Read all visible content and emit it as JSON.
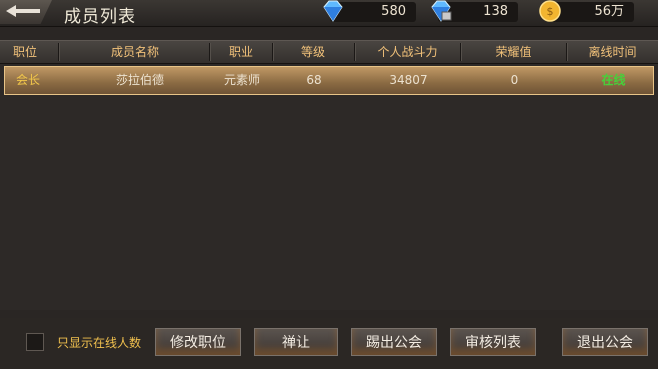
{
  "header": {
    "title": "成员列表",
    "resources": [
      {
        "icon": "diamond-icon",
        "value": "580"
      },
      {
        "icon": "bound-diamond-icon",
        "value": "138"
      },
      {
        "icon": "gold-coin-icon",
        "value": "56万"
      }
    ]
  },
  "table": {
    "columns": [
      "职位",
      "成员名称",
      "职业",
      "等级",
      "个人战斗力",
      "荣耀值",
      "离线时间"
    ],
    "rows": [
      [
        "会长",
        "莎拉伯德",
        "元素师",
        "68",
        "34807",
        "0",
        "在线"
      ]
    ]
  },
  "footer": {
    "online_only_label": "只显示在线人数",
    "buttons": [
      "修改职位",
      "禅让",
      "踢出公会",
      "审核列表",
      "退出公会"
    ]
  },
  "colors": {
    "selected_row": "#a07c4f",
    "header_text": "#f2c27a",
    "online_status": "#47d03a",
    "rank_text": "#f3c84a"
  }
}
